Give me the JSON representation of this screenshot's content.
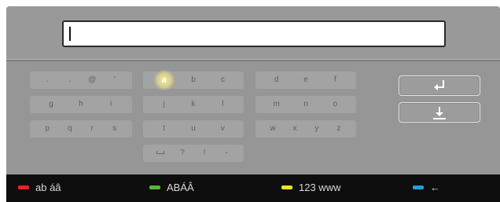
{
  "input": {
    "value": ""
  },
  "keyboard": {
    "groups": [
      {
        "keys": [
          [
            ".",
            ".",
            "@",
            "'"
          ],
          [
            "g",
            "h",
            "i"
          ],
          [
            "p",
            "q",
            "r",
            "s"
          ]
        ]
      },
      {
        "keys": [
          [
            "a",
            "b",
            "c"
          ],
          [
            "j",
            "k",
            "l"
          ],
          [
            "t",
            "u",
            "v"
          ],
          [
            "space",
            "?",
            "!",
            "-"
          ]
        ]
      },
      {
        "keys": [
          [
            "d",
            "e",
            "f"
          ],
          [
            "m",
            "n",
            "o"
          ],
          [
            "w",
            "x",
            "y",
            "z"
          ]
        ]
      }
    ],
    "focused_key": "a"
  },
  "actions": {
    "enter_icon": "enter-icon",
    "download_icon": "download-icon"
  },
  "color_keys": [
    {
      "label": "ab áâ",
      "color": "#e1262b"
    },
    {
      "label": "ABÁÂ",
      "color": "#5ab43a"
    },
    {
      "label": "123 www",
      "color": "#f2e21a"
    },
    {
      "label": "←",
      "color": "#1aa3dc"
    }
  ]
}
